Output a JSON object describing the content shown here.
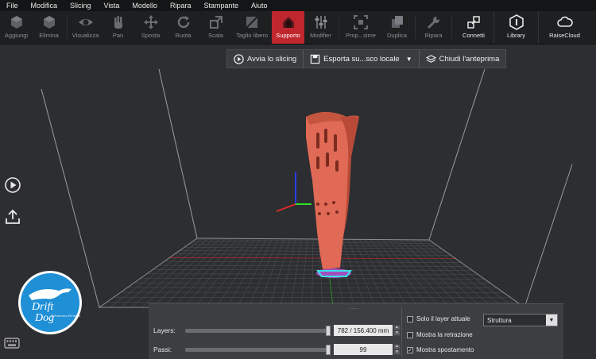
{
  "menu": [
    "File",
    "Modifica",
    "Slicing",
    "Vista",
    "Modello",
    "Ripara",
    "Stampante",
    "Aiuto"
  ],
  "toolbar": {
    "items": [
      {
        "label": "Aggiungi",
        "icon": "cube-add-icon"
      },
      {
        "label": "Elimina",
        "icon": "cube-delete-icon"
      },
      {
        "label": "Visualizza",
        "icon": "eye-icon"
      },
      {
        "label": "Pan",
        "icon": "hand-icon"
      },
      {
        "label": "Sposta",
        "icon": "move-icon"
      },
      {
        "label": "Ruota",
        "icon": "rotate-icon"
      },
      {
        "label": "Scala",
        "icon": "scale-icon"
      },
      {
        "label": "Taglio libero",
        "icon": "cut-icon"
      },
      {
        "label": "Supporto",
        "icon": "support-icon"
      },
      {
        "label": "Modifier",
        "icon": "sliders-icon"
      },
      {
        "label": "Prop...sime",
        "icon": "fit-icon"
      },
      {
        "label": "Duplica",
        "icon": "duplicate-icon"
      },
      {
        "label": "Ripara",
        "icon": "wrench-icon"
      },
      {
        "label": "Connetti",
        "icon": "connect-icon"
      },
      {
        "label": "Library",
        "icon": "library-icon"
      },
      {
        "label": "RaiseCloud",
        "icon": "cloud-icon"
      }
    ],
    "active": "Supporto"
  },
  "preview_bar": {
    "start_slicing": "Avvia lo slicing",
    "export": "Esporta su...sco locale",
    "close_preview": "Chiudi l'anteprima"
  },
  "panel": {
    "grip": "....",
    "layers_label": "Layers:",
    "layers_value": "782 / 156.400 mm",
    "layers_level": 1.0,
    "steps_label": "Passi:",
    "steps_value": "99",
    "steps_level": 1.0,
    "only_current_layer": "Solo il layer attuale",
    "show_retraction": "Mostra la retrazione",
    "show_travel": "Mostra spostamento",
    "view_mode": "Struttura"
  },
  "logo": {
    "line1": "Drift",
    "line2": "Dog",
    "tagline": "di Francesco Ferrabus"
  },
  "colors": {
    "accent": "#c0262d",
    "model": "#e06a55",
    "toolbar_bg": "#1d1f21",
    "panel_bg": "#3c3e42"
  }
}
